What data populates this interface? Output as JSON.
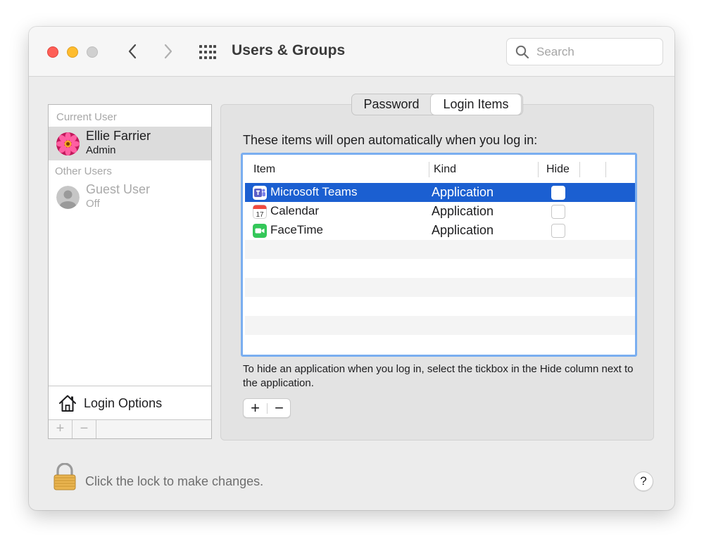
{
  "window": {
    "title": "Users & Groups",
    "search_placeholder": "Search"
  },
  "sidebar": {
    "current_user_header": "Current User",
    "other_users_header": "Other Users",
    "users": [
      {
        "name": "Ellie Farrier",
        "role": "Admin",
        "selected": true
      },
      {
        "name": "Guest User",
        "role": "Off",
        "selected": false
      }
    ],
    "login_options_label": "Login Options",
    "add_symbol": "+",
    "remove_symbol": "−"
  },
  "tabs": {
    "items": [
      "Password",
      "Login Items"
    ],
    "selected": "Login Items"
  },
  "login_items": {
    "description": "These items will open automatically when you log in:",
    "columns": [
      "Item",
      "Kind",
      "Hide"
    ],
    "rows": [
      {
        "item": "Microsoft Teams",
        "kind": "Application",
        "hide": false,
        "icon": "microsoft-teams-icon",
        "selected": true
      },
      {
        "item": "Calendar",
        "kind": "Application",
        "hide": false,
        "icon": "calendar-icon",
        "selected": false
      },
      {
        "item": "FaceTime",
        "kind": "Application",
        "hide": false,
        "icon": "facetime-icon",
        "selected": false
      }
    ],
    "calendar_icon_day": "17",
    "help_text": "To hide an application when you log in, select the tickbox in the Hide column next to the application.",
    "add_symbol": "+",
    "remove_symbol": "−"
  },
  "footer": {
    "lock_text": "Click the lock to make changes.",
    "help_symbol": "?"
  },
  "colors": {
    "selection_blue": "#1b5fd1",
    "focus_ring": "#7aaef0",
    "close_red": "#fe5f57",
    "minimize_yellow": "#febc2e"
  }
}
